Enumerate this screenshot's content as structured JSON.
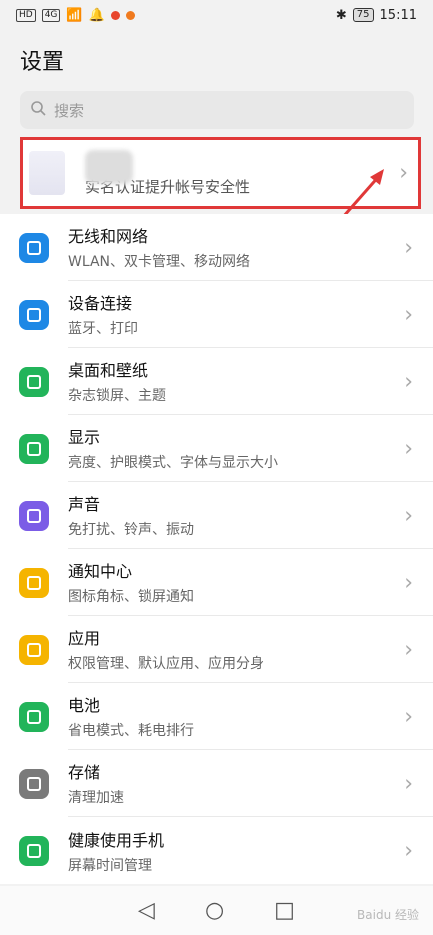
{
  "status": {
    "time": "15:11",
    "battery": "75",
    "hd": "HD",
    "net": "4G"
  },
  "title": "设置",
  "search": {
    "placeholder": "搜索"
  },
  "profile": {
    "subtitle": "实名认证提升帐号安全性"
  },
  "items": [
    {
      "title": "无线和网络",
      "subtitle": "WLAN、双卡管理、移动网络",
      "icon": "wifi-icon",
      "color": "#1e88e5"
    },
    {
      "title": "设备连接",
      "subtitle": "蓝牙、打印",
      "icon": "device-connect-icon",
      "color": "#1e88e5"
    },
    {
      "title": "桌面和壁纸",
      "subtitle": "杂志锁屏、主题",
      "icon": "wallpaper-icon",
      "color": "#22b45a"
    },
    {
      "title": "显示",
      "subtitle": "亮度、护眼模式、字体与显示大小",
      "icon": "display-icon",
      "color": "#22b45a"
    },
    {
      "title": "声音",
      "subtitle": "免打扰、铃声、振动",
      "icon": "sound-icon",
      "color": "#7b5ce6"
    },
    {
      "title": "通知中心",
      "subtitle": "图标角标、锁屏通知",
      "icon": "notification-icon",
      "color": "#f5b400"
    },
    {
      "title": "应用",
      "subtitle": "权限管理、默认应用、应用分身",
      "icon": "apps-icon",
      "color": "#f5b400"
    },
    {
      "title": "电池",
      "subtitle": "省电模式、耗电排行",
      "icon": "battery-icon",
      "color": "#22b45a"
    },
    {
      "title": "存储",
      "subtitle": "清理加速",
      "icon": "storage-icon",
      "color": "#7a7a7a"
    },
    {
      "title": "健康使用手机",
      "subtitle": "屏幕时间管理",
      "icon": "hourglass-icon",
      "color": "#22b45a"
    }
  ],
  "watermark": "Baidu 经验"
}
